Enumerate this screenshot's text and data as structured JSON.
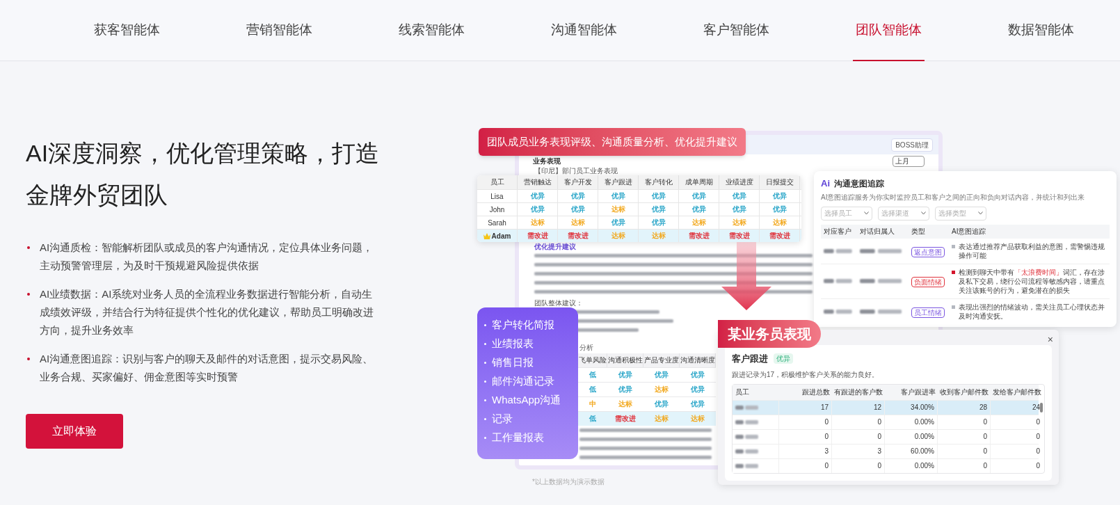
{
  "nav": {
    "tabs": [
      {
        "label": "获客智能体",
        "selected": false
      },
      {
        "label": "营销智能体",
        "selected": false
      },
      {
        "label": "线索智能体",
        "selected": false
      },
      {
        "label": "沟通智能体",
        "selected": false
      },
      {
        "label": "客户智能体",
        "selected": false
      },
      {
        "label": "团队智能体",
        "selected": true
      },
      {
        "label": "数据智能体",
        "selected": false
      }
    ]
  },
  "hero": {
    "title": "AI深度洞察，优化管理策略，打造金牌外贸团队",
    "bullets": [
      "AI沟通质检：智能解析团队或成员的客户沟通情况，定位具体业务问题，主动预警管理层，为及时干预规避风险提供依据",
      "AI业绩数据：AI系统对业务人员的全流程业务数据进行智能分析，自动生成绩效评级，并结合行为特征提供个性化的优化建议，帮助员工明确改进方向，提升业务效率",
      "AI沟通意图追踪：识别与客户的聊天及邮件的对话意图，提示交易风险、业务合规、买家偏好、佣金意图等实时预警"
    ],
    "button": "立即体验"
  },
  "showcase": {
    "banner": "团队成员业务表现评级、沟通质量分析、优化提升建议",
    "report": {
      "badge": "BOSS助理",
      "title": "业务表现",
      "period": "上月",
      "subtitle": "【印尼】部门员工业务表现",
      "advice_title": "优化提升建议",
      "team_title": "团队整体建议：",
      "section_label": "分析"
    },
    "performance_table": {
      "name_header": "员工",
      "columns": [
        "营销触达",
        "客户开发",
        "客户跟进",
        "客户转化",
        "成单周期",
        "业绩进度",
        "日报提交"
      ],
      "rows": [
        {
          "name": "Lisa",
          "crown": false,
          "highlighted": false,
          "cells": [
            {
              "text": "优异",
              "color": "#2aa6c9"
            },
            {
              "text": "优异",
              "color": "#2aa6c9"
            },
            {
              "text": "优异",
              "color": "#2aa6c9"
            },
            {
              "text": "优异",
              "color": "#2aa6c9"
            },
            {
              "text": "优异",
              "color": "#2aa6c9"
            },
            {
              "text": "优异",
              "color": "#2aa6c9"
            },
            {
              "text": "优异",
              "color": "#2aa6c9"
            }
          ]
        },
        {
          "name": "John",
          "crown": false,
          "highlighted": false,
          "cells": [
            {
              "text": "优异",
              "color": "#2aa6c9"
            },
            {
              "text": "优异",
              "color": "#2aa6c9"
            },
            {
              "text": "达标",
              "color": "#f2a81d"
            },
            {
              "text": "优异",
              "color": "#2aa6c9"
            },
            {
              "text": "优异",
              "color": "#2aa6c9"
            },
            {
              "text": "优异",
              "color": "#2aa6c9"
            },
            {
              "text": "优异",
              "color": "#2aa6c9"
            }
          ]
        },
        {
          "name": "Sarah",
          "crown": false,
          "highlighted": false,
          "cells": [
            {
              "text": "达标",
              "color": "#f2a81d"
            },
            {
              "text": "达标",
              "color": "#f2a81d"
            },
            {
              "text": "优异",
              "color": "#2aa6c9"
            },
            {
              "text": "优异",
              "color": "#2aa6c9"
            },
            {
              "text": "达标",
              "color": "#f2a81d"
            },
            {
              "text": "达标",
              "color": "#f2a81d"
            },
            {
              "text": "达标",
              "color": "#f2a81d"
            }
          ]
        },
        {
          "name": "Adam",
          "crown": true,
          "highlighted": true,
          "cells": [
            {
              "text": "需改进",
              "color": "#e0323c"
            },
            {
              "text": "需改进",
              "color": "#e0323c"
            },
            {
              "text": "达标",
              "color": "#f2a81d"
            },
            {
              "text": "达标",
              "color": "#f2a81d"
            },
            {
              "text": "需改进",
              "color": "#e0323c"
            },
            {
              "text": "需改进",
              "color": "#e0323c"
            },
            {
              "text": "需改进",
              "color": "#e0323c"
            }
          ]
        }
      ]
    },
    "quality_table": {
      "columns": [
        "飞单风险",
        "沟通积极性",
        "产品专业度",
        "沟通清晰度"
      ],
      "rows": [
        {
          "highlighted": false,
          "cells": [
            {
              "text": "低",
              "color": "#2aa6c9"
            },
            {
              "text": "优异",
              "color": "#2aa6c9"
            },
            {
              "text": "优异",
              "color": "#2aa6c9"
            },
            {
              "text": "优异",
              "color": "#2aa6c9"
            }
          ]
        },
        {
          "highlighted": false,
          "cells": [
            {
              "text": "低",
              "color": "#2aa6c9"
            },
            {
              "text": "优异",
              "color": "#2aa6c9"
            },
            {
              "text": "达标",
              "color": "#f2a81d"
            },
            {
              "text": "优异",
              "color": "#2aa6c9"
            }
          ]
        },
        {
          "highlighted": false,
          "cells": [
            {
              "text": "中",
              "color": "#f2a81d"
            },
            {
              "text": "达标",
              "color": "#f2a81d"
            },
            {
              "text": "优异",
              "color": "#2aa6c9"
            },
            {
              "text": "优异",
              "color": "#2aa6c9"
            }
          ]
        },
        {
          "highlighted": true,
          "cells": [
            {
              "text": "低",
              "color": "#2aa6c9"
            },
            {
              "text": "需改进",
              "color": "#e0323c"
            },
            {
              "text": "达标",
              "color": "#f2a81d"
            },
            {
              "text": "达标",
              "color": "#f2a81d"
            }
          ]
        }
      ]
    },
    "intent_card": {
      "logo": "Ai",
      "title": "沟通意图追踪",
      "subtitle": "AI意图追踪服务为你实时监控员工和客户之间的正向和负向对话内容，并统计和列出来",
      "filters": [
        {
          "placeholder": "选择员工"
        },
        {
          "placeholder": "选择渠道"
        },
        {
          "placeholder": "选择类型"
        }
      ],
      "columns": [
        "对应客户",
        "对话归属人",
        "类型",
        "AI意图追踪"
      ],
      "rows": [
        {
          "tag": {
            "label": "返点意图",
            "color": "#7a55e0"
          },
          "color": "#b4b8c0",
          "intent": [
            {
              "text": "表达通过推荐产品获取利益的意图，需警惕违规操作可能",
              "highlight": false
            }
          ]
        },
        {
          "tag": {
            "label": "负面情绪",
            "color": "#e0323c"
          },
          "color": "#d4142c",
          "intent": [
            {
              "text": "检测到聊天中带有",
              "highlight": false
            },
            {
              "text": "「太浪费时间」",
              "highlight": true
            },
            {
              "text": "词汇，存在涉及私下交易，绕行公司流程等敏感内容，请重点关注该账号的行为，避免潜在的损失",
              "highlight": false
            }
          ]
        },
        {
          "tag": {
            "label": "员工情绪",
            "color": "#7a55e0"
          },
          "color": "#b4b8c0",
          "intent": [
            {
              "text": "表现出强烈的情绪波动，需关注员工心理状态并及时沟通安抚。",
              "highlight": false
            }
          ]
        }
      ]
    },
    "features": [
      "客户转化简报",
      "业绩报表",
      "销售日报",
      "邮件沟通记录",
      "WhatsApp沟通",
      "记录",
      "工作量报表"
    ],
    "member_modal": {
      "tag": "某业务员表现",
      "close": "×",
      "section": "客户跟进",
      "badge": "优异",
      "summary": "跟进记录为17，积极维护客户关系的能力良好。",
      "name_header": "员工",
      "columns": [
        "跟进总数",
        "有跟进的客户数",
        "客户跟进率",
        "收到客户邮件数",
        "发给客户邮件数"
      ],
      "rows": [
        {
          "selected": true,
          "values": [
            "17",
            "12",
            "34.00%",
            "28",
            "24"
          ]
        },
        {
          "selected": false,
          "values": [
            "0",
            "0",
            "0.00%",
            "0",
            "0"
          ]
        },
        {
          "selected": false,
          "values": [
            "0",
            "0",
            "0.00%",
            "0",
            "0"
          ]
        },
        {
          "selected": false,
          "values": [
            "3",
            "3",
            "60.00%",
            "0",
            "0"
          ]
        },
        {
          "selected": false,
          "values": [
            "0",
            "0",
            "0.00%",
            "0",
            "0"
          ]
        }
      ]
    },
    "footnote": "*以上数据均为演示数据"
  }
}
